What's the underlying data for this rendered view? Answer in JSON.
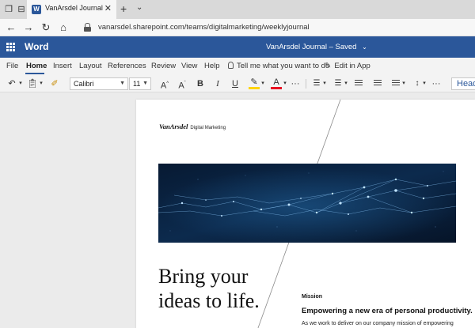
{
  "browser": {
    "tab_title": "VanArsdel Journal",
    "tab_close": "✕",
    "new_tab": "+",
    "tab_menu": "⌄",
    "url": "vanarsdel.sharepoint.com/teams/digitalmarketing/weeklyjournal"
  },
  "app": {
    "name": "Word",
    "doc_title": "VanArsdel Journal",
    "save_status": "– Saved"
  },
  "ribbon": {
    "tabs": [
      "File",
      "Home",
      "Insert",
      "Layout",
      "References",
      "Review",
      "View",
      "Help"
    ],
    "active_tab": "Home",
    "tell_me": "Tell me what you want to do",
    "edit_in_app": "Edit in App"
  },
  "toolbar": {
    "font": "Calibri",
    "font_size": "11",
    "bold": "B",
    "italic": "I",
    "underline": "U",
    "more": "···",
    "heading_style": "Heading"
  },
  "document": {
    "brand_logo": "VanArsdel",
    "brand_sub": "Digital Marketing",
    "headline_line1": "Bring your",
    "headline_line2": "ideas to life.",
    "mission_label": "Mission",
    "mission_heading": "Empowering a new era of personal productivity.",
    "mission_body": "As we work to deliver on our company mission of empowering"
  },
  "colors": {
    "word_blue": "#2b579a",
    "highlight": "#ffd400",
    "font_color": "#e81123"
  }
}
